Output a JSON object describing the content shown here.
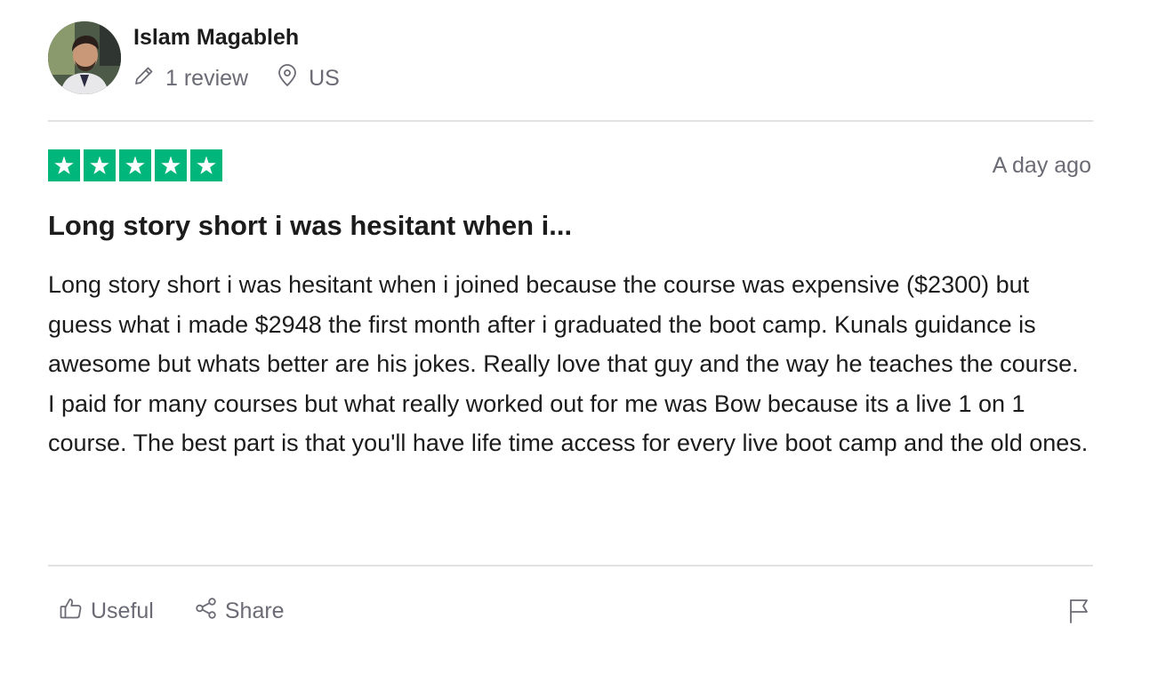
{
  "author": {
    "name": "Islam Magableh",
    "reviews": "1 review",
    "country": "US"
  },
  "rating": {
    "stars": 5,
    "max": 5,
    "color": "#00b67a"
  },
  "date": "A day ago",
  "review": {
    "title": "Long story short i was hesitant when i...",
    "paragraphs": [
      "Long story short i was hesitant when i joined because the course was expensive ($2300) but guess what i made $2948 the first month after i graduated the boot camp. Kunals guidance is awesome but whats better are his jokes. Really love that guy and the way he teaches the course.",
      "I paid for many courses but what really worked out for me was Bow because its a live 1 on 1 course. The best part is that you'll have life time access for every live boot camp and the old ones."
    ]
  },
  "actions": {
    "useful": "Useful",
    "share": "Share"
  },
  "icons": {
    "reviews": "pencil-icon",
    "country": "location-pin-icon",
    "useful": "thumbs-up-icon",
    "share": "share-icon",
    "report": "flag-icon"
  }
}
